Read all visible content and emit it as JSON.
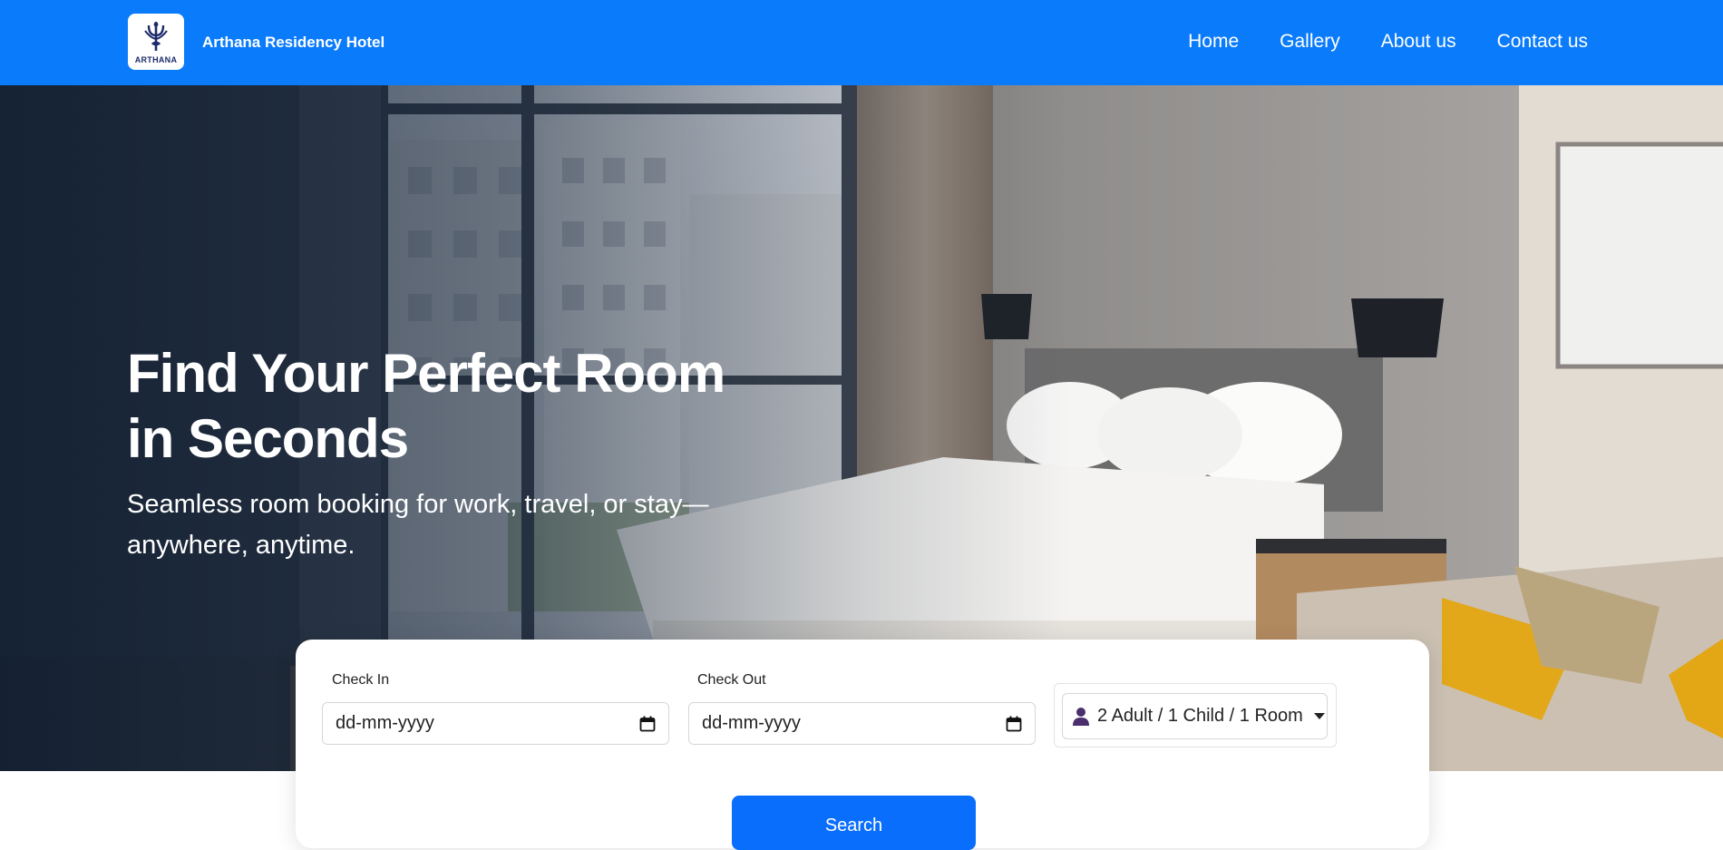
{
  "brand": {
    "logo_text": "ARTHANA",
    "name": "Arthana Residency Hotel"
  },
  "nav": {
    "items": [
      {
        "label": "Home"
      },
      {
        "label": "Gallery"
      },
      {
        "label": "About us"
      },
      {
        "label": "Contact us"
      }
    ]
  },
  "hero": {
    "title_line1": "Find Your Perfect Room",
    "title_line2": "in Seconds",
    "subtitle": "Seamless room booking for work, travel, or stay—anywhere, anytime."
  },
  "booking": {
    "check_in": {
      "label": "Check In",
      "value": "dd-mm-yyyy"
    },
    "check_out": {
      "label": "Check Out",
      "value": "dd-mm-yyyy"
    },
    "guests": {
      "value": "2 Adult / 1 Child / 1 Room"
    },
    "search_label": "Search"
  },
  "colors": {
    "primary": "#0a7bfb",
    "button": "#0a6efd"
  },
  "icons": {
    "calendar": "calendar-icon",
    "person": "person-icon",
    "caret": "caret-down-icon"
  }
}
